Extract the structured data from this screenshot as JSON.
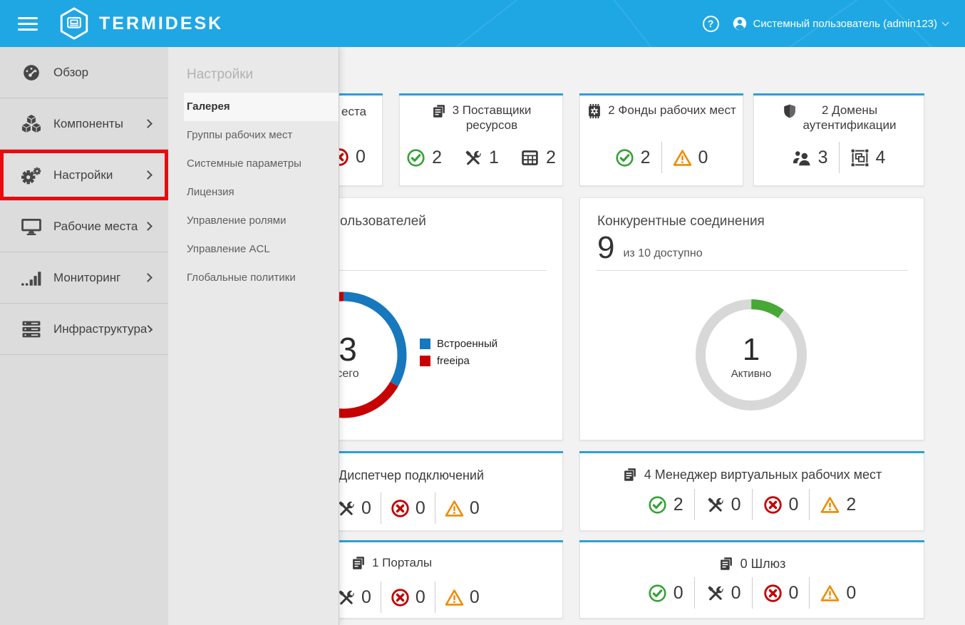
{
  "colors": {
    "header_blue": "#1fa7e4",
    "card_top_border": "#2d9fd6",
    "status_green": "#35a135",
    "status_red": "#c40000",
    "status_orange": "#ee8b00",
    "sidebar_highlight_red": "#ea0c0c"
  },
  "header": {
    "brand": "TERMIDESK",
    "help_label": "?",
    "user_label": "Системный пользователь (admin123)"
  },
  "sidebar": {
    "items": [
      {
        "label": "Обзор"
      },
      {
        "label": "Компоненты"
      },
      {
        "label": "Настройки"
      },
      {
        "label": "Рабочие места"
      },
      {
        "label": "Мониторинг"
      },
      {
        "label": "Инфраструктура"
      }
    ]
  },
  "submenu": {
    "title": "Настройки",
    "items": [
      {
        "label": "Галерея",
        "active": true
      },
      {
        "label": "Группы рабочих мест"
      },
      {
        "label": "Системные параметры"
      },
      {
        "label": "Лицензия"
      },
      {
        "label": "Управление ролями"
      },
      {
        "label": "Управление ACL"
      },
      {
        "label": "Глобальные политики"
      }
    ]
  },
  "stat_cards": {
    "workplaces": {
      "title_fragment": "еста",
      "stats": [
        {
          "icon": "x-circle-icon",
          "value": "0"
        }
      ]
    },
    "providers": {
      "title_line1": "3 Поставщики",
      "title_line2": "ресурсов",
      "stats": [
        {
          "icon": "check-circle-icon",
          "value": "2"
        },
        {
          "icon": "tools-icon",
          "value": "1"
        },
        {
          "icon": "table-icon",
          "value": "2"
        }
      ]
    },
    "pools": {
      "title": "2 Фонды рабочих мест",
      "stats": [
        {
          "icon": "check-circle-icon",
          "value": "2"
        },
        {
          "icon": "warning-icon",
          "value": "0"
        }
      ]
    },
    "domains": {
      "title_line1": "2 Домены",
      "title_line2": "аутентификации",
      "stats": [
        {
          "icon": "users-icon",
          "value": "3"
        },
        {
          "icon": "object-group-icon",
          "value": "4"
        }
      ]
    },
    "dispatcher": {
      "title_fragment": "Диспетчер подключений",
      "stats": [
        {
          "icon": "tools-icon",
          "value": "0"
        },
        {
          "icon": "x-circle-icon",
          "value": "0"
        },
        {
          "icon": "warning-icon",
          "value": "0"
        }
      ]
    },
    "vdi_manager": {
      "title": "4 Менеджер виртуальных рабочих мест",
      "stats": [
        {
          "icon": "check-circle-icon",
          "value": "2"
        },
        {
          "icon": "tools-icon",
          "value": "0"
        },
        {
          "icon": "x-circle-icon",
          "value": "0"
        },
        {
          "icon": "warning-icon",
          "value": "2"
        }
      ]
    },
    "portals": {
      "title": "1 Порталы",
      "stats": [
        {
          "icon": "tools-icon",
          "value": "0"
        },
        {
          "icon": "x-circle-icon",
          "value": "0"
        },
        {
          "icon": "warning-icon",
          "value": "0"
        }
      ]
    },
    "gateway": {
      "title": "0 Шлюз",
      "stats": [
        {
          "icon": "check-circle-icon",
          "value": "0"
        },
        {
          "icon": "tools-icon",
          "value": "0"
        },
        {
          "icon": "x-circle-icon",
          "value": "0"
        },
        {
          "icon": "warning-icon",
          "value": "0"
        }
      ]
    }
  },
  "chart_data": {
    "users": {
      "type": "pie",
      "title_fragment": "ользователей",
      "center_value": "3",
      "center_label_fragment": "сего",
      "legend_position": "right",
      "series": [
        {
          "name": "Встроенный",
          "value": 1,
          "color": "#1778be"
        },
        {
          "name": "freeipa",
          "value": 2,
          "color": "#c70000"
        }
      ]
    },
    "connections": {
      "type": "pie",
      "title": "Конкурентные соединения",
      "big_number": "9",
      "big_number_suffix": "из 10 доступно",
      "center_value": "1",
      "center_label": "Активно",
      "series": [
        {
          "name": "Активно",
          "value": 1,
          "color": "#46a835"
        },
        {
          "name": "Доступно",
          "value": 9,
          "color": "#d8d8d8"
        }
      ]
    }
  }
}
